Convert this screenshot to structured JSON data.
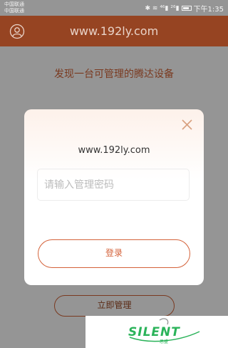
{
  "status_bar": {
    "carrier_1": "中国联通",
    "carrier_2": "中国联通",
    "signal_icons": "✱ ≋ ⁴⁶▮ ²⁶▮",
    "time": "下午1:35"
  },
  "header": {
    "title": "www.192ly.com",
    "user_icon": "user-circle-icon"
  },
  "page": {
    "found_text": "发现一台可管理的腾达设备",
    "manage_button": "立即管理"
  },
  "modal": {
    "domain": "www.192ly.com",
    "password_placeholder": "请输入管理密码",
    "password_value": "",
    "login_button": "登录",
    "close_icon": "close-icon"
  },
  "watermark": {
    "brand": "SILENT",
    "sub": "思盛"
  },
  "colors": {
    "header_bg": "#964422",
    "accent": "#d4623a",
    "overlay_bg": "#959595",
    "watermark_green": "#2bb35a"
  }
}
